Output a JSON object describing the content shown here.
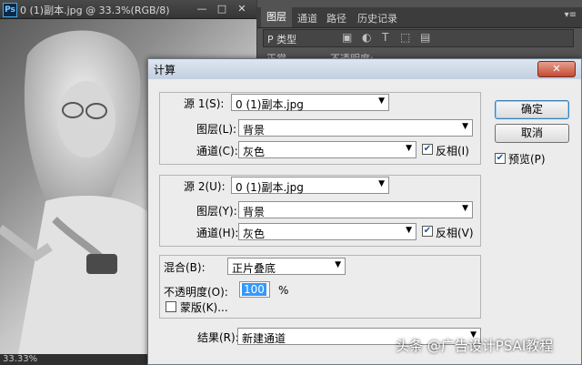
{
  "document": {
    "title": "0 (1)副本.jpg @ 33.3%(RGB/8)",
    "zoom_status": "33.33%",
    "minimize_glyph": "—",
    "maximize_glyph": "□",
    "close_glyph": "✕"
  },
  "layers_panel": {
    "tabs": [
      "图层",
      "通道",
      "路径",
      "历史记录"
    ],
    "menu_glyph": "▾≡",
    "filter_label": "P 类型",
    "blend_mode_partial": "正常",
    "opacity_partial": "不透明度:"
  },
  "dialog": {
    "title": "计算",
    "close_glyph": "✕",
    "source1": {
      "label": "源 1(S):",
      "value": "0 (1)副本.jpg",
      "layer_label": "图层(L):",
      "layer_value": "背景",
      "channel_label": "通道(C):",
      "channel_value": "灰色",
      "invert_label": "反相(I)",
      "invert_checked": true
    },
    "source2": {
      "label": "源 2(U):",
      "value": "0 (1)副本.jpg",
      "layer_label": "图层(Y):",
      "layer_value": "背景",
      "channel_label": "通道(H):",
      "channel_value": "灰色",
      "invert_label": "反相(V)",
      "invert_checked": true
    },
    "blending": {
      "label": "混合(B):",
      "value": "正片叠底",
      "opacity_label": "不透明度(O):",
      "opacity_value": "100",
      "opacity_unit": "%",
      "mask_label": "蒙版(K)...",
      "mask_checked": false
    },
    "result": {
      "label": "结果(R):",
      "value": "新建通道"
    },
    "buttons": {
      "ok": "确定",
      "cancel": "取消"
    },
    "preview_label": "预览(P)",
    "preview_checked": true
  },
  "watermark": "头条 @广告设计PSAI教程",
  "check_glyph": "✔",
  "arrow_glyph": "▼"
}
